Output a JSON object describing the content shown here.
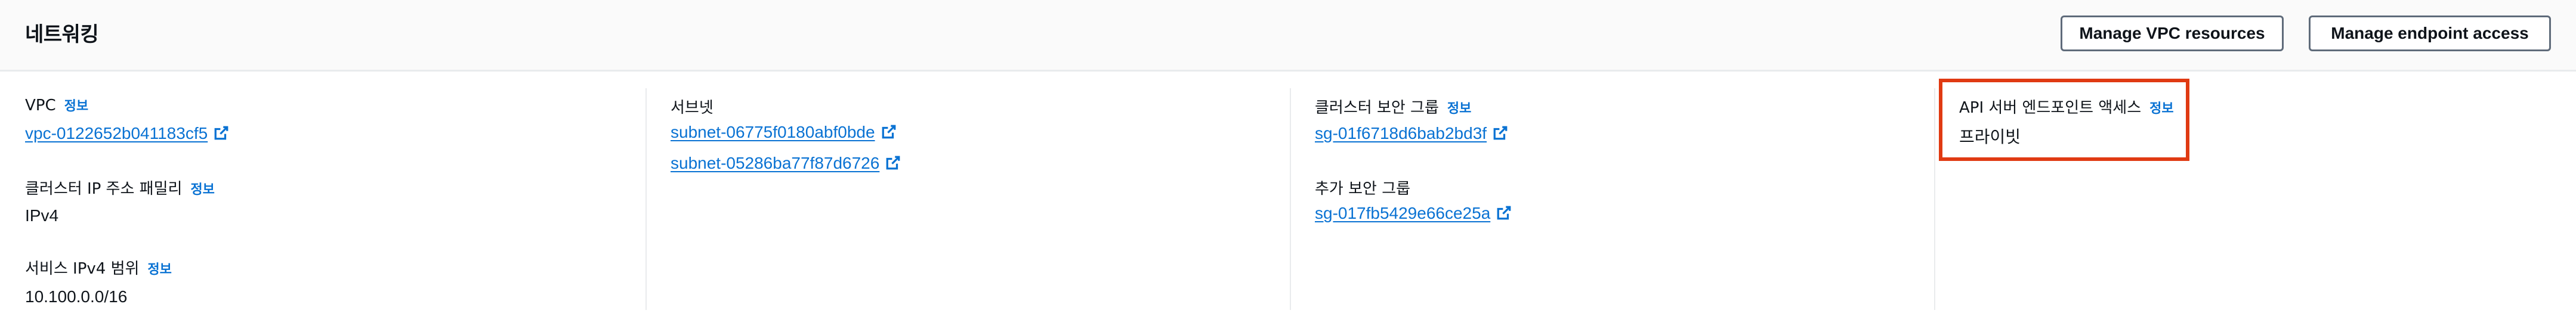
{
  "header": {
    "title": "네트워킹",
    "manage_vpc_label": "Manage VPC resources",
    "manage_endpoint_label": "Manage endpoint access"
  },
  "info_label": "정보",
  "col1": {
    "vpc_label": "VPC",
    "vpc_value": "vpc-0122652b041183cf5",
    "ip_family_label": "클러스터 IP 주소 패밀리",
    "ip_family_value": "IPv4",
    "service_range_label": "서비스 IPv4 범위",
    "service_range_value": "10.100.0.0/16"
  },
  "col2": {
    "subnets_label": "서브넷",
    "subnets": [
      "subnet-06775f0180abf0bde",
      "subnet-05286ba77f87d6726"
    ]
  },
  "col3": {
    "cluster_sg_label": "클러스터 보안 그룹",
    "cluster_sg_value": "sg-01f6718d6bab2bd3f",
    "additional_sg_label": "추가 보안 그룹",
    "additional_sg_value": "sg-017fb5429e66ce25a"
  },
  "col4": {
    "endpoint_access_label": "API 서버 엔드포인트 액세스",
    "endpoint_access_value": "프라이빗"
  },
  "colors": {
    "link": "#0972d3",
    "highlight": "#e03a12",
    "button_border": "#5f6b7a"
  }
}
